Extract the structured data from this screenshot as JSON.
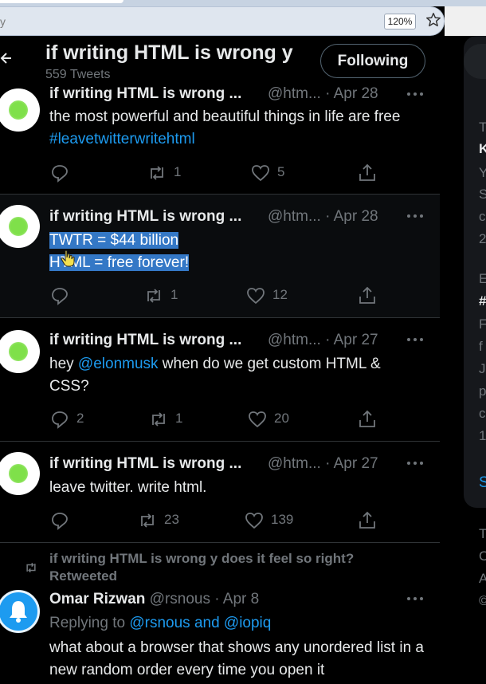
{
  "browser": {
    "address_fragment": "y",
    "zoom": "120%",
    "star_icon": "bookmark-star-icon"
  },
  "header": {
    "title": "if writing HTML is wrong y",
    "tweet_count": "559 Tweets",
    "follow_label": "Following"
  },
  "tweets": [
    {
      "name": "if writing HTML is wrong ...",
      "handle": "@htm... · Apr 28",
      "text": "the most powerful and beautiful things in life are free ",
      "hashtag": "#leavetwitterwritehtml",
      "replies": "",
      "retweets": "1",
      "likes": "5"
    },
    {
      "name": "if writing HTML is wrong ...",
      "handle": "@htm... · Apr 28",
      "line1": "TWTR = $44 billion",
      "line2": "HTML = free forever!",
      "replies": "",
      "retweets": "1",
      "likes": "12"
    },
    {
      "name": "if writing HTML is wrong ...",
      "handle": "@htm... · Apr 27",
      "text_pre": "hey ",
      "mention": "@elonmusk",
      "text_post": " when do we get custom HTML & CSS?",
      "replies": "2",
      "retweets": "1",
      "likes": "20"
    },
    {
      "name": "if writing HTML is wrong ...",
      "handle": "@htm... · Apr 27",
      "text": "leave twitter. write html.",
      "replies": "",
      "retweets": "23",
      "likes": "139"
    },
    {
      "retweeted_by": "if writing HTML is wrong y does it feel so right?",
      "retweeted_label": "Retweeted",
      "name": "Omar Rizwan",
      "handle": "@rsnous · Apr 8",
      "replying_to_label": "Replying to ",
      "replying_to": "@rsnous and @iopiq",
      "text": "what about a browser that shows any unordered list in a new random order every time you open it"
    }
  ],
  "right_column": {
    "letters": [
      "T",
      "K",
      "Y",
      "S",
      "c",
      "2",
      "E",
      "#",
      "F",
      "f",
      "J",
      "p",
      "c",
      "1",
      "S",
      "T",
      "C",
      "A",
      "©"
    ]
  },
  "colors": {
    "link": "#1d9bf0",
    "muted": "#71767b",
    "text": "#e7e9ea",
    "selection": "#3478c6",
    "divider": "#2f3336"
  }
}
